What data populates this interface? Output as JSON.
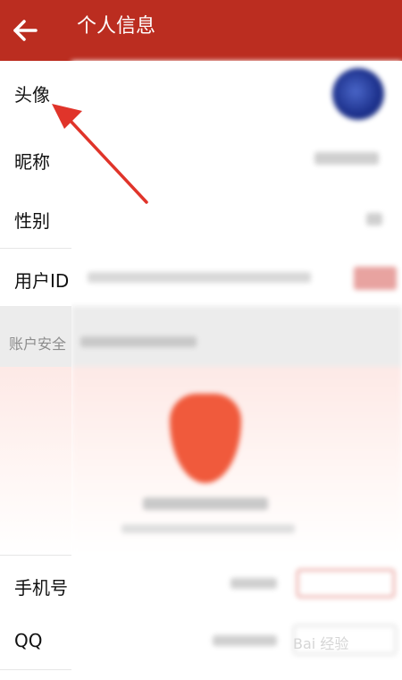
{
  "header": {
    "title": "个人信息",
    "back_icon": "arrow-left-icon",
    "bg": "#bb2d20"
  },
  "rows": {
    "avatar": "头像",
    "nickname": "昵称",
    "gender": "性别",
    "user_id": "用户ID",
    "phone": "手机号",
    "qq": "QQ"
  },
  "section": {
    "account_security": "账户安全"
  },
  "annotation": {
    "icon": "pointer-arrow-icon",
    "color": "#e0342a"
  },
  "watermark": {
    "text": "Bai 经验"
  }
}
